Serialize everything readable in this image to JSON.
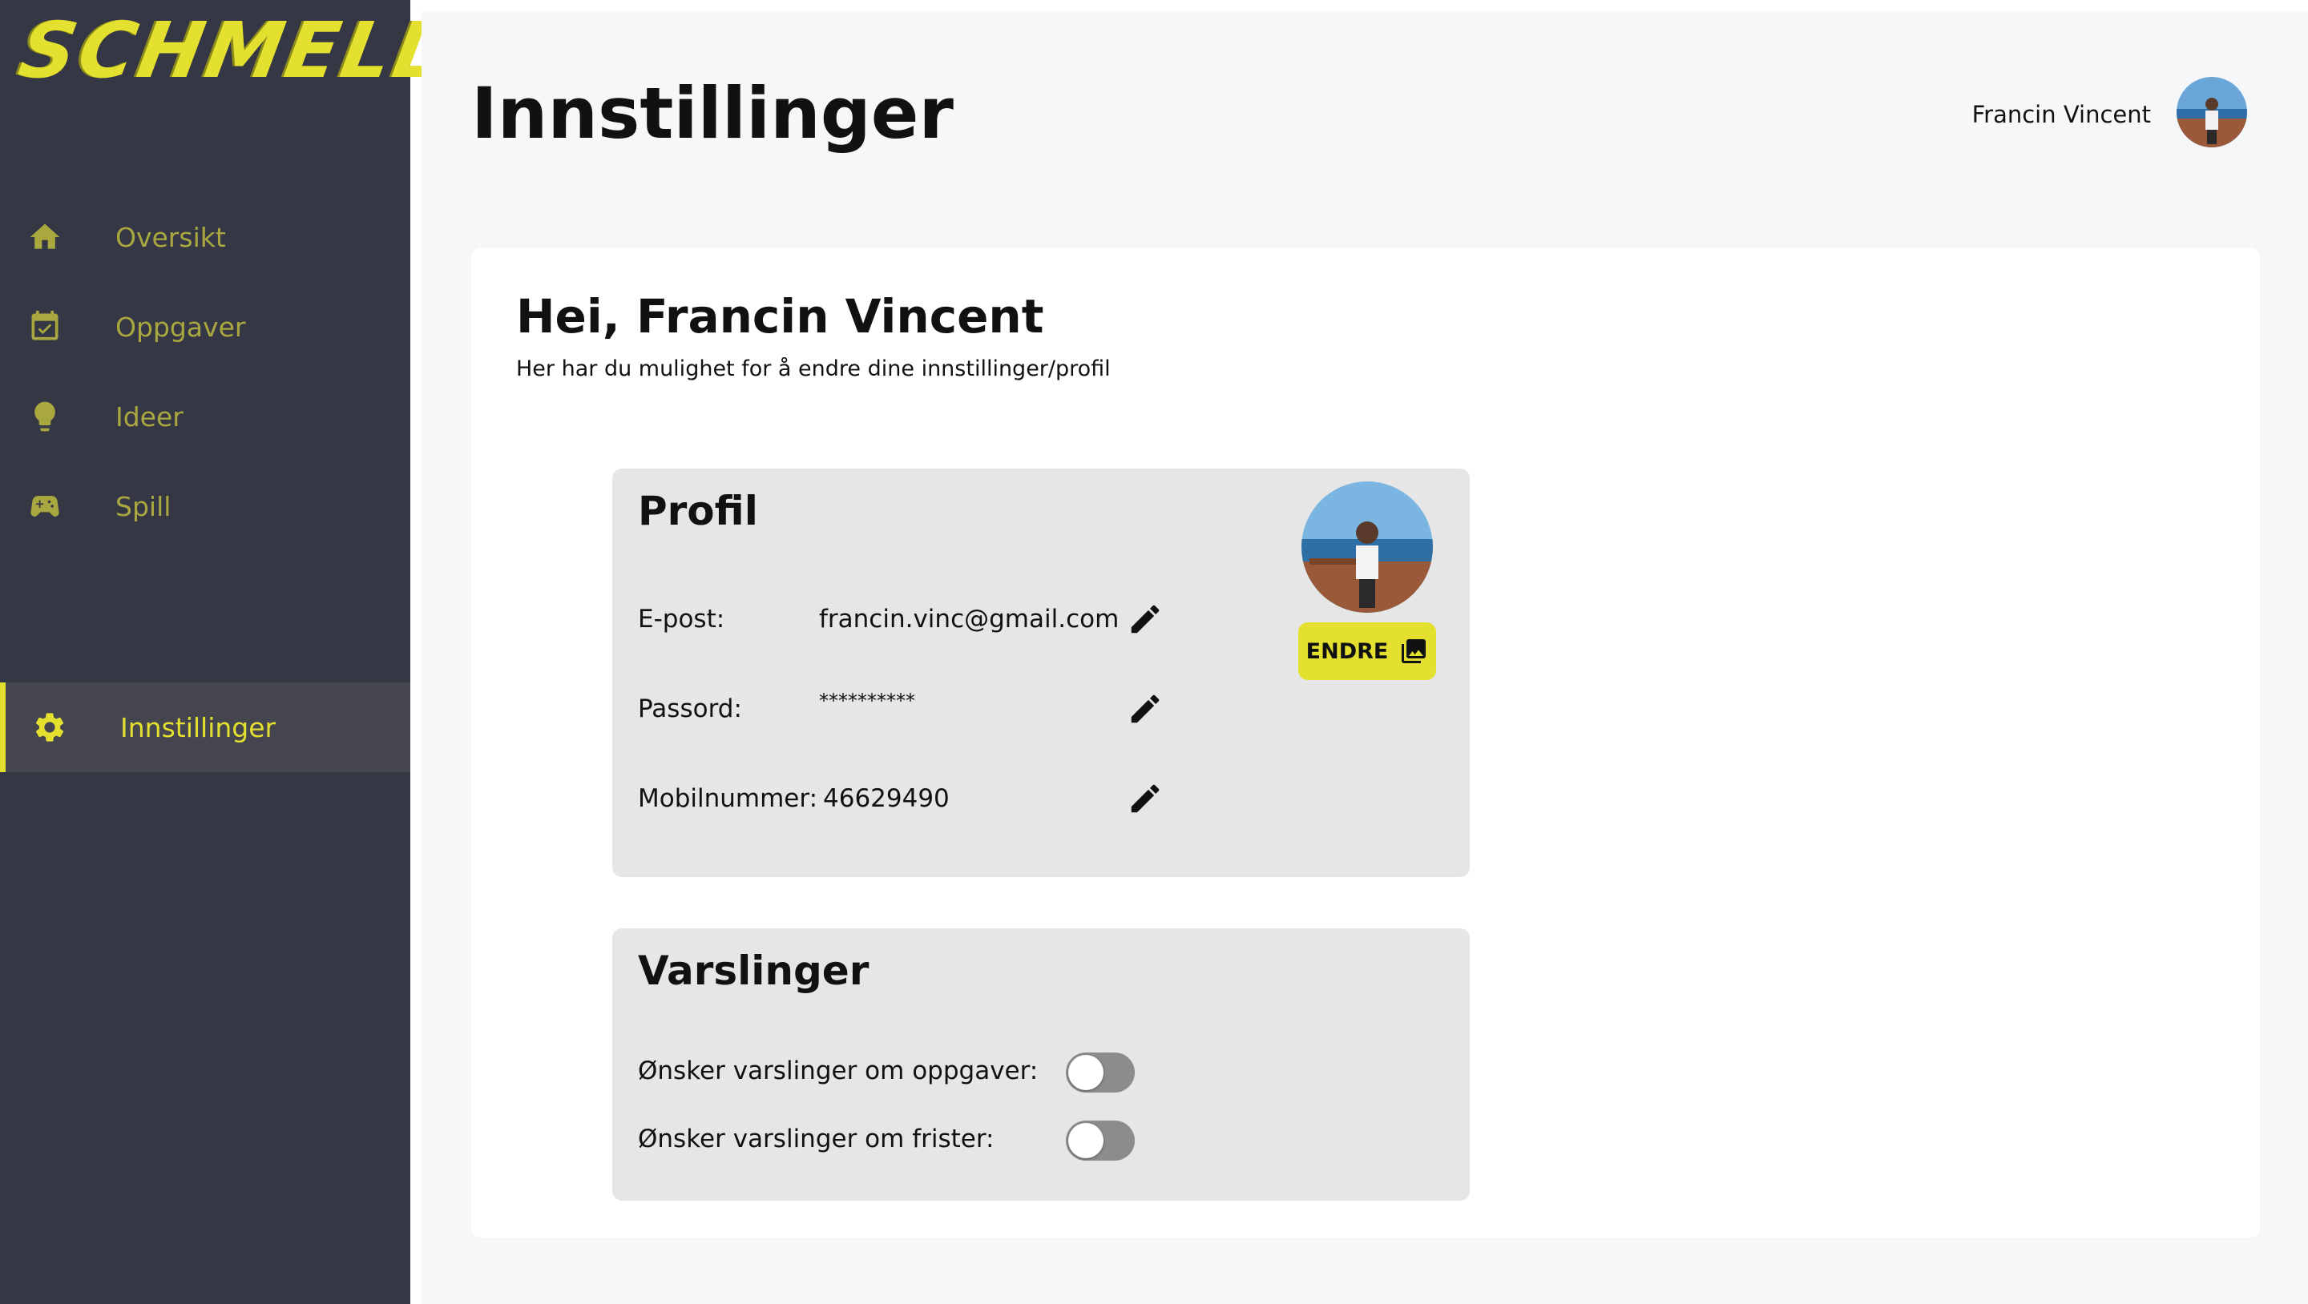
{
  "brand": {
    "logo_text": "SCHMELL!",
    "accent_color": "#e3e02f",
    "sidebar_color": "#363744"
  },
  "sidebar": {
    "items": [
      {
        "label": "Oversikt",
        "icon": "home-icon"
      },
      {
        "label": "Oppgaver",
        "icon": "calendar-check-icon"
      },
      {
        "label": "Ideer",
        "icon": "lightbulb-icon"
      },
      {
        "label": "Spill",
        "icon": "gamepad-icon"
      }
    ],
    "settings": {
      "label": "Innstillinger",
      "icon": "gear-icon",
      "active": true
    }
  },
  "header": {
    "title": "Innstillinger",
    "user_name": "Francin Vincent"
  },
  "card": {
    "greeting": "Hei, Francin Vincent",
    "subtitle": "Her har du mulighet for å endre dine innstillinger/profil"
  },
  "profile": {
    "title": "Profil",
    "email_label": "E-post:",
    "email_value": "francin.vinc@gmail.com",
    "password_label": "Passord:",
    "password_value": "**********",
    "phone_label": "Mobilnummer:",
    "phone_value": "46629490",
    "change_photo_label": "ENDRE"
  },
  "notifications": {
    "title": "Varslinger",
    "tasks_label": "Ønsker varslinger om oppgaver:",
    "tasks_enabled": false,
    "deadlines_label": "Ønsker varslinger om frister:",
    "deadlines_enabled": false
  }
}
